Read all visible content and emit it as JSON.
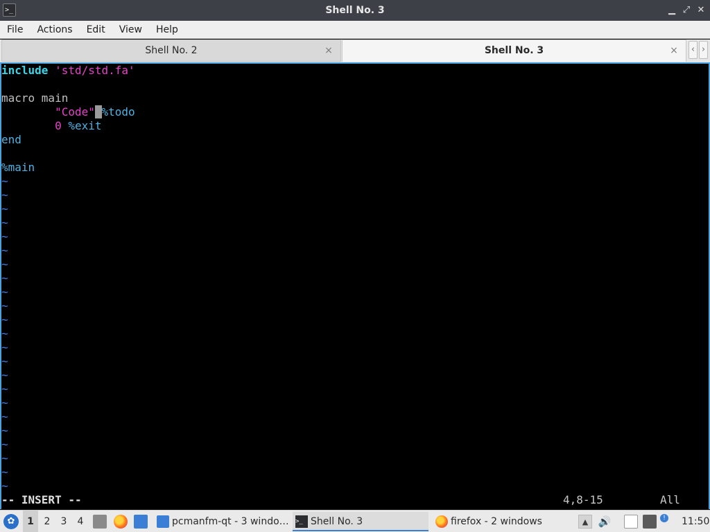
{
  "window": {
    "title": "Shell No. 3",
    "app_icon_glyph": ">_",
    "controls": {
      "minimize": "▁",
      "maximize": "⤢",
      "close": "✕"
    }
  },
  "menu": [
    "File",
    "Actions",
    "Edit",
    "View",
    "Help"
  ],
  "tabs": [
    {
      "label": "Shell No. 2",
      "active": false
    },
    {
      "label": "Shell No. 3",
      "active": true
    }
  ],
  "tab_close_glyph": "×",
  "tab_scroll": {
    "left": "‹",
    "right": "›"
  },
  "editor": {
    "lines": [
      {
        "kw": "include",
        "str": "'std/std.fa'"
      },
      {
        "text": ""
      },
      {
        "text": "macro main"
      },
      {
        "indent": "        ",
        "str": "\"Code\"",
        "cursor": " ",
        "rest": "%todo"
      },
      {
        "indent": "        ",
        "num": "0",
        "rest": " %exit"
      },
      {
        "text": "end"
      },
      {
        "text": ""
      },
      {
        "text": "%main"
      }
    ],
    "tilde": "~",
    "tilde_count": 23,
    "status": {
      "mode": "-- INSERT --",
      "position": "4,8-15",
      "scroll": "All"
    }
  },
  "taskbar": {
    "start_glyph": "✿",
    "desktops": [
      "1",
      "2",
      "3",
      "4"
    ],
    "active_desktop": "1",
    "tasks": [
      {
        "label": "pcmanfm-qt - 3 windo…",
        "icon": "folder-icon",
        "active": false
      },
      {
        "label": "Shell No. 3",
        "icon": "terminal-icon",
        "active": true
      },
      {
        "label": "firefox - 2 windows",
        "icon": "firefox-icon",
        "active": false
      }
    ],
    "tray": {
      "volume": "🔊",
      "notification_badge": "!"
    },
    "clock": "11:50"
  }
}
